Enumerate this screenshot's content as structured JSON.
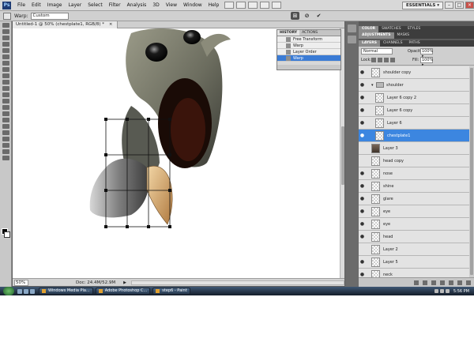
{
  "menubar": {
    "logo": "Ps",
    "items": [
      "File",
      "Edit",
      "Image",
      "Layer",
      "Select",
      "Filter",
      "Analysis",
      "3D",
      "View",
      "Window",
      "Help"
    ],
    "workspace": "ESSENTIALS ▾",
    "min": "–",
    "max": "□",
    "close": "×"
  },
  "options": {
    "warp_label": "Warp:",
    "warp_value": "Custom"
  },
  "document": {
    "tab_title": "Untitled-1 @ 50% (chestplate1, RGB/8) *",
    "tab_close": "×",
    "zoom": "50%",
    "doc_size": "Doc: 24.4M/52.9M",
    "status_arrow": "▶"
  },
  "history": {
    "tabs": [
      "HISTORY",
      "ACTIONS"
    ],
    "items": [
      "Free Transform",
      "Warp",
      "Layer Order",
      "Warp"
    ]
  },
  "panels": {
    "color_tabs": [
      "COLOR",
      "SWATCHES",
      "STYLES"
    ],
    "adj_tabs": [
      "ADJUSTMENTS",
      "MASKS"
    ],
    "layers_tabs": [
      "LAYERS",
      "CHANNELS",
      "PATHS"
    ],
    "blend_mode": "Normal",
    "opacity_label": "Opacity:",
    "opacity_value": "100% ▸",
    "lock_label": "Lock:",
    "fill_label": "Fill:",
    "fill_value": "100% ▸"
  },
  "layers": [
    {
      "name": "shoulder copy",
      "visible": true,
      "type": "layer",
      "indent": false,
      "selected": false
    },
    {
      "name": "shoulder",
      "visible": true,
      "type": "group",
      "indent": false,
      "selected": false
    },
    {
      "name": "Layer 6 copy 2",
      "visible": true,
      "type": "layer",
      "indent": true,
      "selected": false
    },
    {
      "name": "Layer 6 copy",
      "visible": true,
      "type": "layer",
      "indent": true,
      "selected": false
    },
    {
      "name": "Layer 6",
      "visible": true,
      "type": "layer",
      "indent": true,
      "selected": false
    },
    {
      "name": "chestplate1",
      "visible": true,
      "type": "layer",
      "indent": true,
      "selected": true
    },
    {
      "name": "Layer 3",
      "visible": false,
      "type": "photo",
      "indent": false,
      "selected": false
    },
    {
      "name": "head copy",
      "visible": false,
      "type": "layer",
      "indent": false,
      "selected": false
    },
    {
      "name": "nose",
      "visible": true,
      "type": "layer",
      "indent": false,
      "selected": false
    },
    {
      "name": "shine",
      "visible": true,
      "type": "layer",
      "indent": false,
      "selected": false
    },
    {
      "name": "glare",
      "visible": true,
      "type": "layer",
      "indent": false,
      "selected": false
    },
    {
      "name": "eye",
      "visible": true,
      "type": "layer",
      "indent": false,
      "selected": false
    },
    {
      "name": "eye",
      "visible": true,
      "type": "layer",
      "indent": false,
      "selected": false
    },
    {
      "name": "head",
      "visible": true,
      "type": "layer",
      "indent": false,
      "selected": false
    },
    {
      "name": "Layer 2",
      "visible": false,
      "type": "layer",
      "indent": false,
      "selected": false
    },
    {
      "name": "Layer 5",
      "visible": true,
      "type": "layer",
      "indent": false,
      "selected": false
    },
    {
      "name": "neck",
      "visible": true,
      "type": "layer",
      "indent": false,
      "selected": false
    }
  ],
  "taskbar": {
    "tasks": [
      "Windows Media Pla...",
      "Adobe Photoshop C...",
      "step6 - Paint"
    ],
    "clock": "5:56 PM"
  },
  "colors": {
    "accent": "#3c86e0",
    "taskbar": "#1f2d40",
    "canvas": "#ffffff"
  }
}
